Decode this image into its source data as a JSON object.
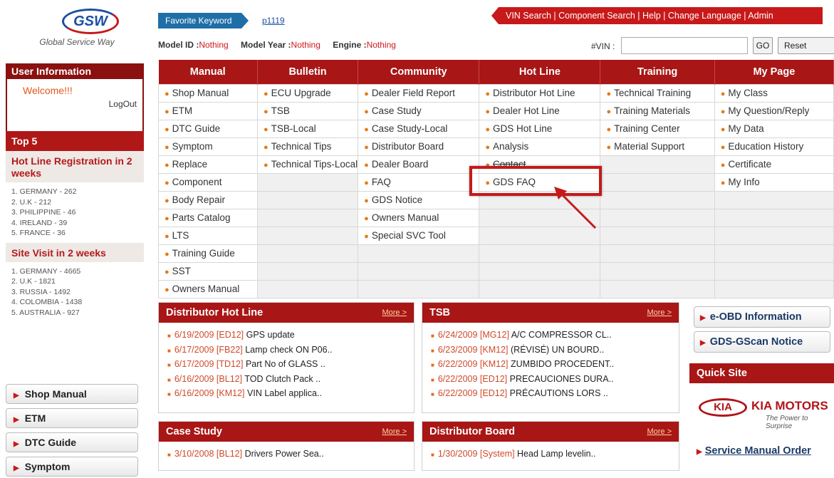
{
  "header": {
    "logo_text": "GSW",
    "logo_subtitle": "Global Service Way",
    "favorite_keyword_label": "Favorite Keyword",
    "favorite_keyword_value": "p1119",
    "top_links": "VIN Search | Component Search | Help | Change Language | Admin",
    "model_id_label": "Model ID :",
    "model_id_value": "Nothing",
    "model_year_label": "Model Year :",
    "model_year_value": "Nothing",
    "engine_label": "Engine :",
    "engine_value": "Nothing",
    "vin_label": "#VIN :",
    "vin_value": "",
    "go_label": "GO",
    "reset_label": "Reset"
  },
  "sidebar": {
    "user_info_title": "User Information",
    "welcome": "Welcome!!!",
    "logout": "LogOut",
    "top5_title": "Top 5",
    "hotline_title": "Hot Line Registration in 2 weeks",
    "hotline_items": [
      "1. GERMANY - 262",
      "2. U.K - 212",
      "3. PHILIPPINE - 46",
      "4. IRELAND - 39",
      "5. FRANCE - 36"
    ],
    "visit_title": "Site Visit in 2 weeks",
    "visit_items": [
      "1. GERMANY - 4665",
      "2. U.K - 1821",
      "3. RUSSIA - 1492",
      "4. COLOMBIA - 1438",
      "5. AUSTRALIA - 927"
    ],
    "buttons": [
      "Shop Manual",
      "ETM",
      "DTC Guide",
      "Symptom"
    ]
  },
  "nav": {
    "columns": [
      {
        "title": "Manual",
        "items": [
          "Shop Manual",
          "ETM",
          "DTC Guide",
          "Symptom",
          "Replace",
          "Component",
          "Body Repair",
          "Parts Catalog",
          "LTS",
          "Training Guide",
          "SST",
          "Owners Manual"
        ]
      },
      {
        "title": "Bulletin",
        "items": [
          "ECU Upgrade",
          "TSB",
          "TSB-Local",
          "Technical Tips",
          "Technical Tips-Local"
        ]
      },
      {
        "title": "Community",
        "items": [
          "Dealer Field Report",
          "Case Study",
          "Case Study-Local",
          "Distributor Board",
          "Dealer Board",
          "FAQ",
          "GDS Notice",
          "Owners Manual",
          "Special SVC Tool"
        ]
      },
      {
        "title": "Hot Line",
        "items": [
          "Distributor Hot Line",
          "Dealer Hot Line",
          "GDS Hot Line",
          "Analysis",
          "Contact",
          "GDS FAQ"
        ]
      },
      {
        "title": "Training",
        "items": [
          "Technical Training",
          "Training Materials",
          "Training Center",
          "Material Support"
        ]
      },
      {
        "title": "My Page",
        "items": [
          "My Class",
          "My Question/Reply",
          "My Data",
          "Education History",
          "Certificate",
          "My Info"
        ]
      }
    ]
  },
  "panels": {
    "more": "More >",
    "distributor_hotline": {
      "title": "Distributor Hot Line",
      "items": [
        {
          "date": "6/19/2009 [ED12]",
          "text": "GPS update"
        },
        {
          "date": "6/17/2009 [FB22]",
          "text": "Lamp check ON P06.."
        },
        {
          "date": "6/17/2009 [TD12]",
          "text": "Part No of GLASS .."
        },
        {
          "date": "6/16/2009 [BL12]",
          "text": "TOD Clutch Pack .."
        },
        {
          "date": "6/16/2009 [KM12]",
          "text": "VIN Label applica.."
        }
      ]
    },
    "tsb": {
      "title": "TSB",
      "items": [
        {
          "date": "6/24/2009 [MG12]",
          "text": "A/C COMPRESSOR CL.."
        },
        {
          "date": "6/23/2009 [KM12]",
          "text": "(RÉVISÉ) UN BOURD.."
        },
        {
          "date": "6/22/2009 [KM12]",
          "text": "ZUMBIDO PROCEDENT.."
        },
        {
          "date": "6/22/2009 [ED12]",
          "text": "PRECAUCIONES DURA.."
        },
        {
          "date": "6/22/2009 [ED12]",
          "text": "PRÉCAUTIONS LORS .."
        }
      ]
    },
    "case_study": {
      "title": "Case Study",
      "items": [
        {
          "date": "3/10/2008 [BL12]",
          "text": "Drivers Power Sea.."
        }
      ]
    },
    "distributor_board": {
      "title": "Distributor Board",
      "items": [
        {
          "date": "1/30/2009 [System]",
          "text": "Head Lamp levelin.."
        }
      ]
    }
  },
  "right": {
    "eobd": "e-OBD Information",
    "gscan": "GDS-GScan Notice",
    "quick_site": "Quick Site",
    "kia_logo": "KIA",
    "kia_name": "KIA MOTORS",
    "kia_tag": "The Power to Surprise",
    "service_manual_order": "Service Manual Order"
  }
}
